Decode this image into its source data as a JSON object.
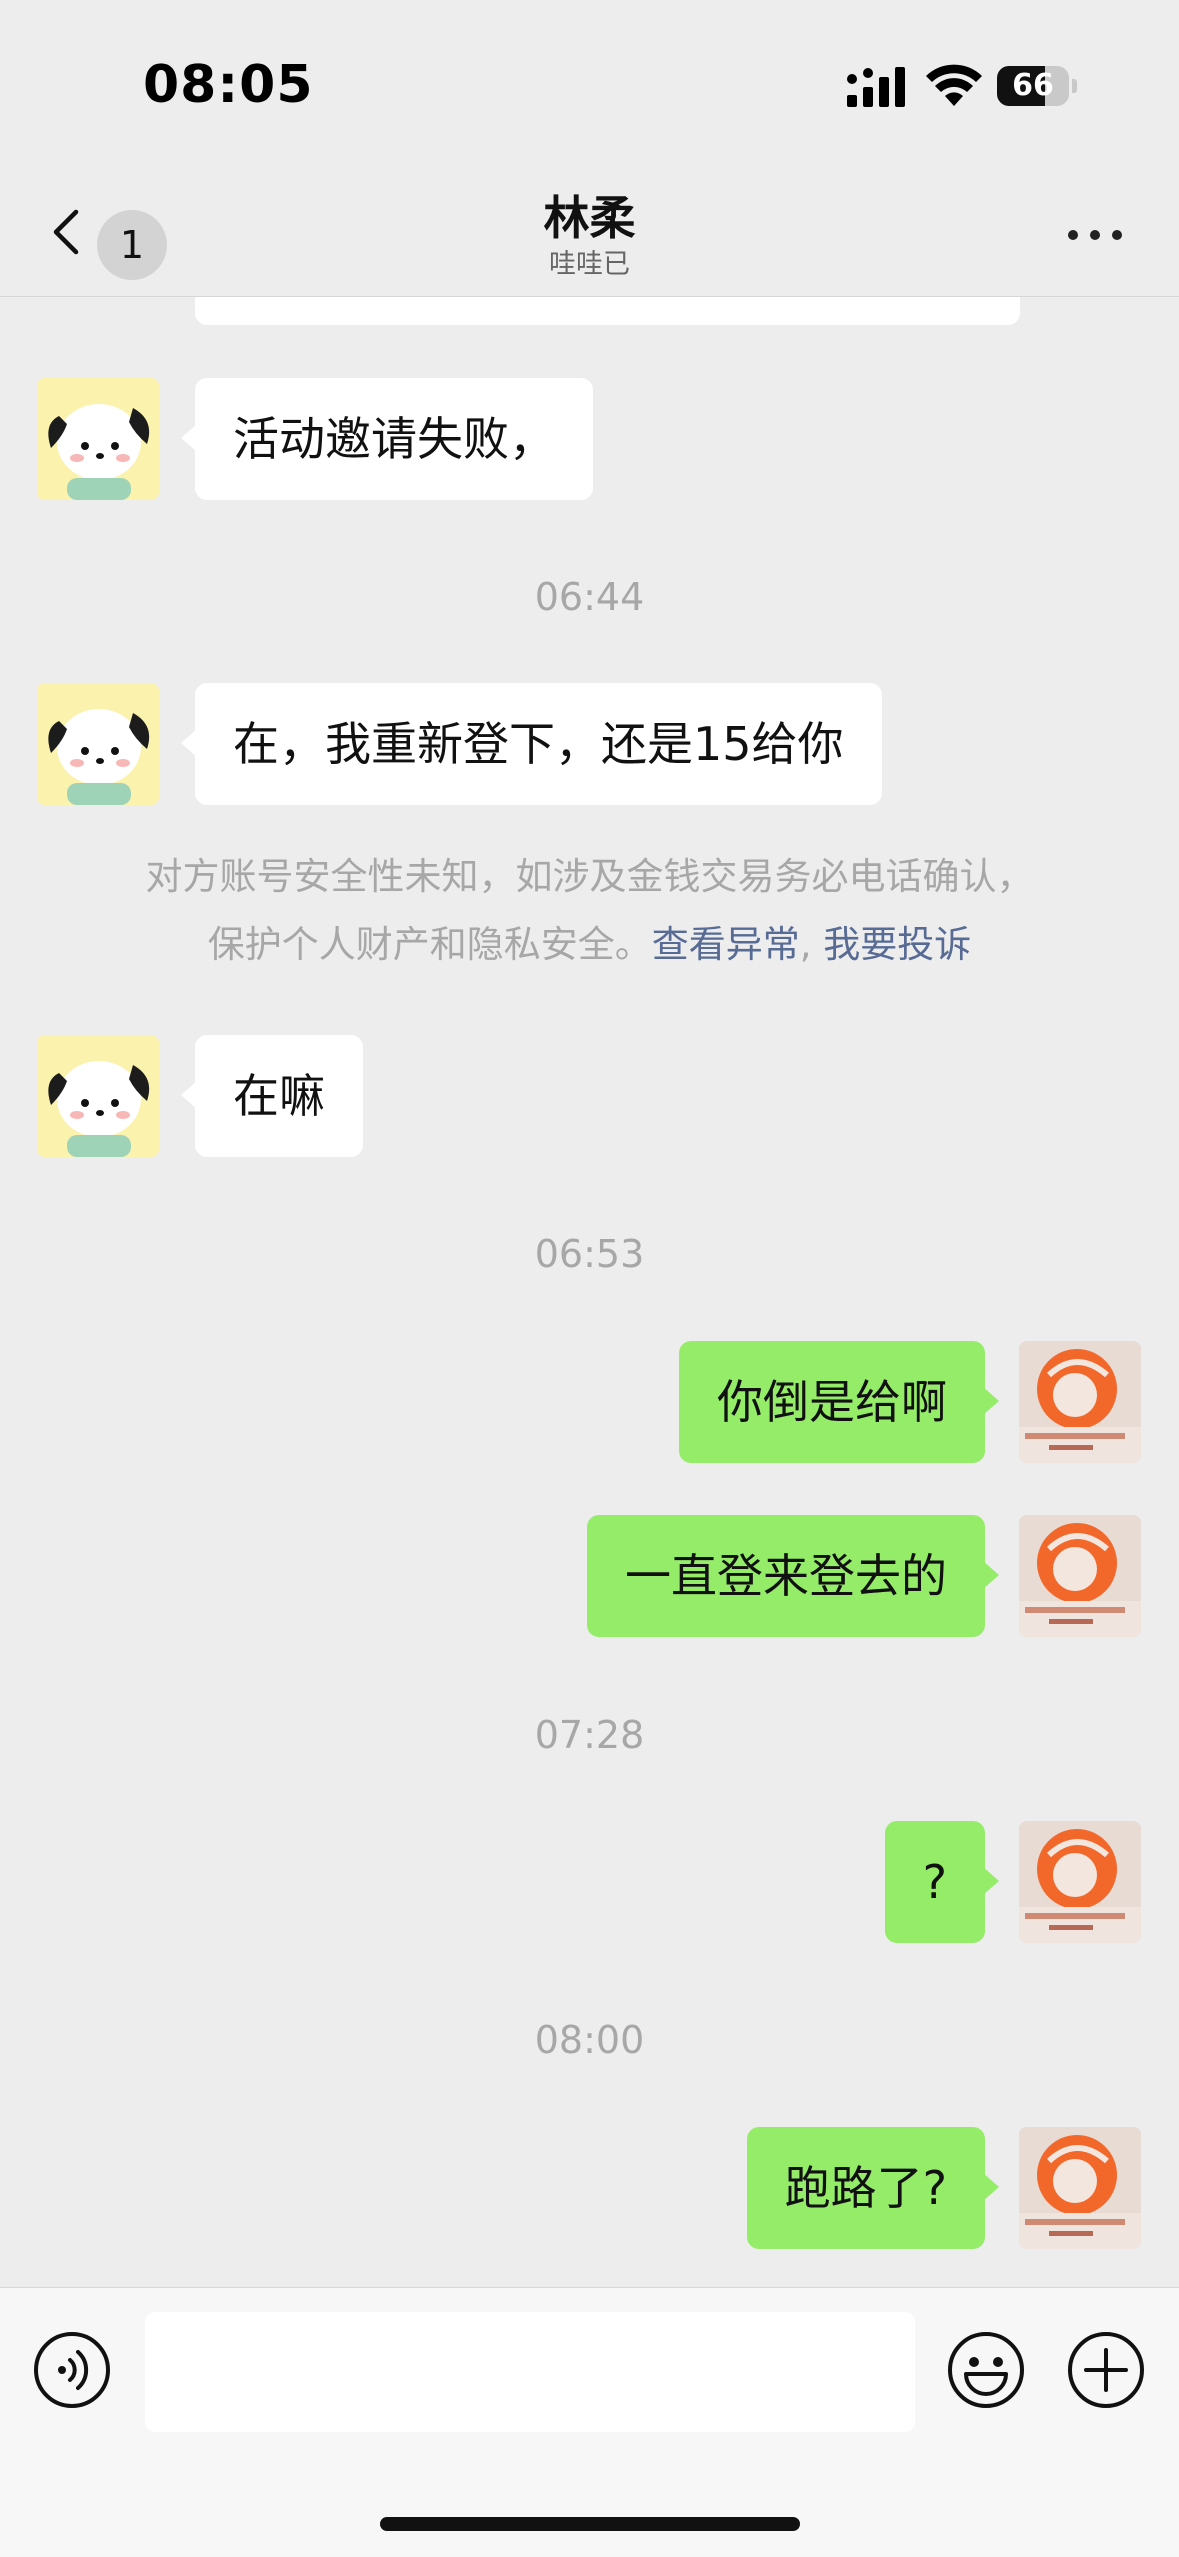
{
  "status_bar": {
    "time": "08:05",
    "battery_level": "66",
    "battery_fraction": 0.66
  },
  "nav": {
    "unread_count": "1",
    "title": "林柔",
    "subtitle": "哇哇已"
  },
  "messages": [
    {
      "type": "in",
      "text": "活动邀请失败，"
    },
    {
      "type": "time",
      "text": "06:44"
    },
    {
      "type": "in",
      "text": "在，我重新登下，还是15给你"
    },
    {
      "type": "notice",
      "line1": "对方账号安全性未知，如涉及金钱交易务必电话确认，",
      "line2_prefix": "保护个人财产和隐私安全。",
      "link1": "查看异常",
      "separator": ", ",
      "link2": "我要投诉"
    },
    {
      "type": "in",
      "text": "在嘛"
    },
    {
      "type": "time",
      "text": "06:53"
    },
    {
      "type": "out",
      "text": "你倒是给啊"
    },
    {
      "type": "out",
      "text": "一直登来登去的"
    },
    {
      "type": "time",
      "text": "07:28"
    },
    {
      "type": "out",
      "text": "?"
    },
    {
      "type": "time",
      "text": "08:00"
    },
    {
      "type": "out",
      "text": "跑路了?"
    }
  ],
  "input_bar": {
    "placeholder": ""
  },
  "colors": {
    "background": "#ededed",
    "out_bubble": "#95ec69",
    "in_bubble": "#ffffff",
    "link": "#576b95"
  }
}
